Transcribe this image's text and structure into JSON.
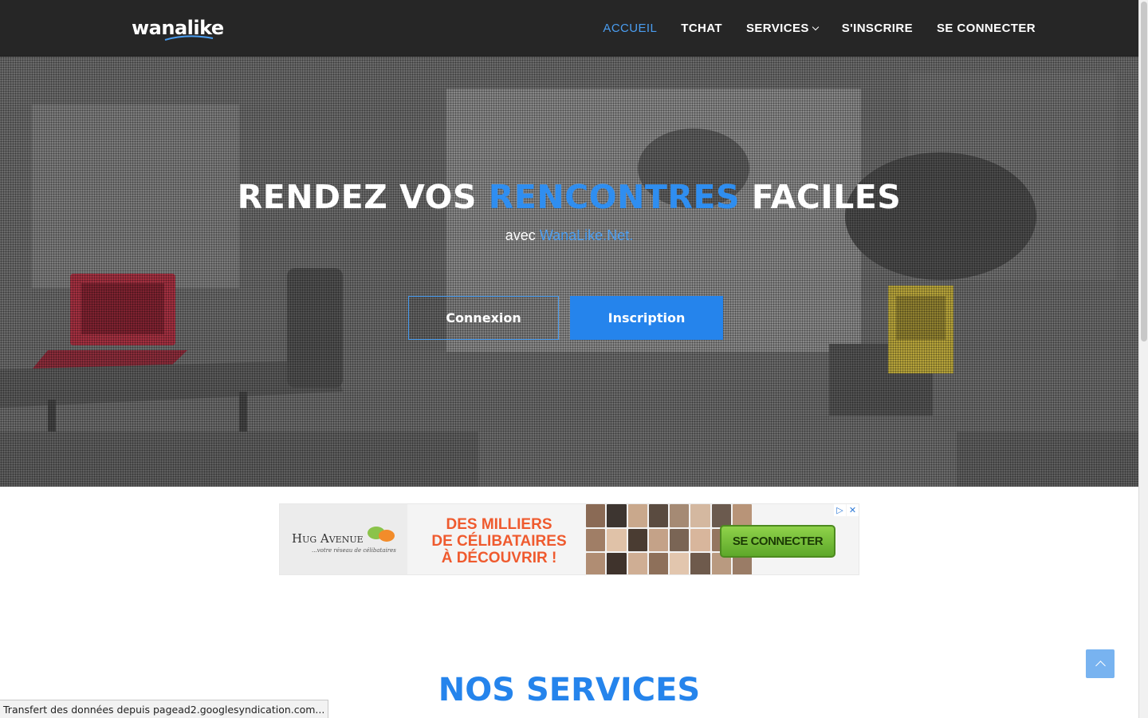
{
  "brand": {
    "logo_text": "wanalike"
  },
  "nav": {
    "items": [
      {
        "label": "ACCUEIL",
        "active": true
      },
      {
        "label": "TCHAT"
      },
      {
        "label": "SERVICES"
      },
      {
        "label": "S'INSCRIRE"
      },
      {
        "label": "SE CONNECTER"
      }
    ]
  },
  "hero": {
    "title_part1": "RENDEZ VOS ",
    "title_highlight": "RENCONTRES",
    "title_part2": " FACILES",
    "subtitle_prefix": "avec ",
    "subtitle_link": "WanaLike.Net.",
    "btn_connexion": "Connexion",
    "btn_inscription": "Inscription"
  },
  "ad": {
    "brand_name": "Hug Avenue",
    "brand_tagline": "...votre réseau de célibataires",
    "headline_lines": [
      "DES MILLIERS",
      "DE CÉLIBATAIRES",
      "À DÉCOUVRIR !"
    ],
    "cta": "SE CONNECTER"
  },
  "services": {
    "title_light": "NOS ",
    "title_bold": "SERVICES"
  },
  "status_bar": {
    "text": "Transfert des données depuis pagead2.googlesyndication.com..."
  },
  "colors": {
    "accent": "#2584ec",
    "navbar": "#262626",
    "ad_headline": "#ef5a2e",
    "ad_cta": "#6bbf30"
  },
  "icons": {
    "dropdown": "chevron-down-icon",
    "to_top": "chevron-up-icon",
    "ad_choices": "adchoices-icon",
    "ad_close": "close-icon"
  }
}
